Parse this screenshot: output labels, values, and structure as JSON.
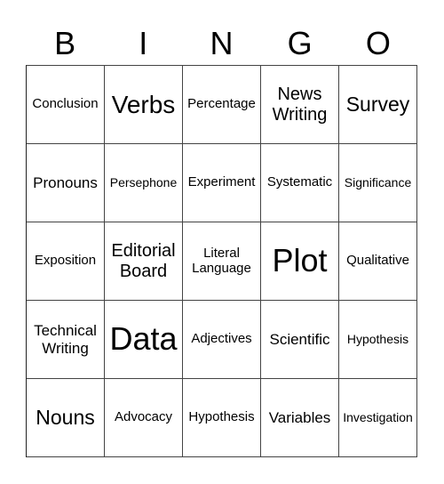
{
  "header": {
    "letters": [
      "B",
      "I",
      "N",
      "G",
      "O"
    ]
  },
  "grid": {
    "rows": [
      [
        "Conclusion",
        "Verbs",
        "Percentage",
        "News Writing",
        "Survey"
      ],
      [
        "Pronouns",
        "Persephone",
        "Experiment",
        "Systematic",
        "Significance"
      ],
      [
        "Exposition",
        "Editorial Board",
        "Literal Language",
        "Plot",
        "Qualitative"
      ],
      [
        "Technical Writing",
        "Data",
        "Adjectives",
        "Scientific",
        "Hypothesis"
      ],
      [
        "Nouns",
        "Advocacy",
        "Hypothesis",
        "Variables",
        "Investigation"
      ]
    ]
  }
}
